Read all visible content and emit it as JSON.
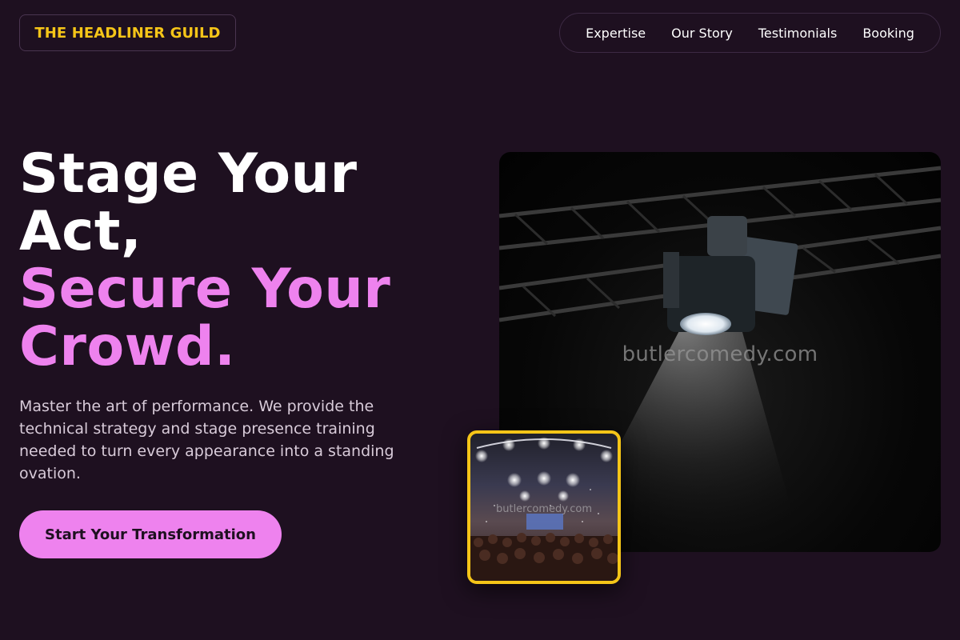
{
  "brand": {
    "name": "THE HEADLINER GUILD"
  },
  "nav": {
    "items": [
      {
        "label": "Expertise"
      },
      {
        "label": "Our Story"
      },
      {
        "label": "Testimonials"
      },
      {
        "label": "Booking"
      }
    ]
  },
  "hero": {
    "headline_lines": [
      "Stage Your",
      "Act,",
      "Secure Your",
      "Crowd."
    ],
    "subcopy": "Master the art of performance. We provide the technical strategy and stage presence training needed to turn every appearance into a standing ovation.",
    "cta_label": "Start Your Transformation"
  },
  "images": {
    "stage_watermark": "butlercomedy.com",
    "thumb_watermark": "butlercomedy.com"
  },
  "colors": {
    "background": "#1e1020",
    "accent_pink": "#ee82ee",
    "accent_gold": "#f5c518"
  }
}
